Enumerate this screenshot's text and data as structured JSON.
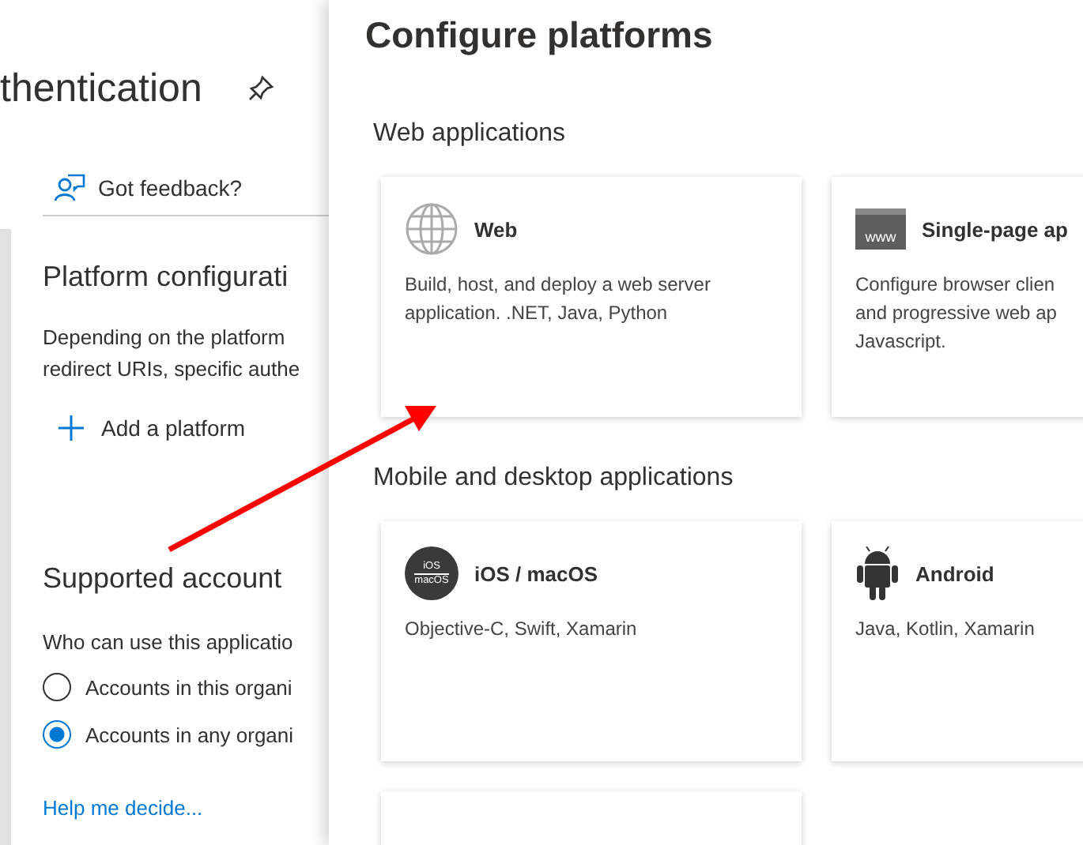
{
  "blade": {
    "title": "thentication",
    "feedback": "Got feedback?",
    "platform_section": {
      "heading": "Platform configurati",
      "description_lines": [
        "Depending on the platform",
        "redirect URIs, specific authe"
      ],
      "add_button": "Add a platform"
    },
    "account_section": {
      "heading": "Supported account",
      "question": "Who can use this applicatio",
      "options": [
        {
          "label": "Accounts in this organi",
          "selected": false
        },
        {
          "label": "Accounts in any organi",
          "selected": true
        }
      ],
      "help_link": "Help me decide..."
    }
  },
  "panel": {
    "title": "Configure platforms",
    "groups": [
      {
        "heading": "Web applications",
        "cards": [
          {
            "kind": "globe",
            "title": "Web",
            "description_lines": [
              "Build, host, and deploy a web server",
              "application. .NET, Java, Python"
            ]
          },
          {
            "kind": "www",
            "icon_text": "www",
            "title": "Single-page ap",
            "description_lines": [
              "Configure browser clien",
              "and progressive web ap",
              "Javascript."
            ]
          }
        ]
      },
      {
        "heading": "Mobile and desktop applications",
        "cards": [
          {
            "kind": "ios",
            "icon_text": "iOS",
            "icon_subtext": "macOS",
            "title": "iOS / macOS",
            "description_lines": [
              "Objective-C, Swift, Xamarin"
            ]
          },
          {
            "kind": "android",
            "title": "Android",
            "description_lines": [
              "Java, Kotlin, Xamarin"
            ]
          },
          {
            "kind": "empty"
          }
        ]
      }
    ]
  }
}
